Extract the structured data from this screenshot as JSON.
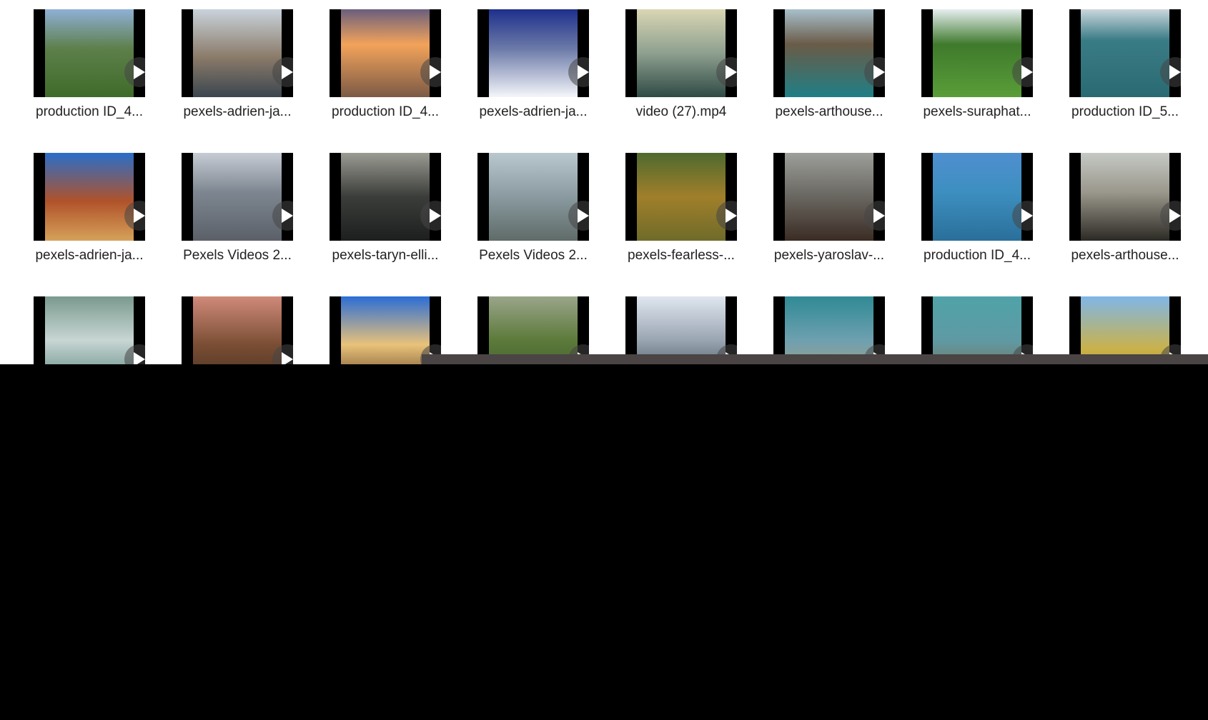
{
  "videos": [
    {
      "name": "production ID_4...",
      "bg": "linear-gradient(180deg,#8fb0d6 0%,#5d7f4a 45%,#3f6b2a 100%)",
      "play_icon": "play-icon"
    },
    {
      "name": "pexels-adrien-ja...",
      "bg": "linear-gradient(180deg,#c9d3dc 0%,#8a7a68 55%,#3b4650 100%)",
      "play_icon": "play-icon"
    },
    {
      "name": "production ID_4...",
      "bg": "linear-gradient(180deg,#6a5f7d 0%,#f3a35a 40%,#7b5a45 100%)",
      "play_icon": "play-icon"
    },
    {
      "name": "pexels-adrien-ja...",
      "bg": "linear-gradient(180deg,#1e2f8c 0%,#6c7aa8 45%,#f4f6fa 100%)",
      "play_icon": "play-icon"
    },
    {
      "name": "video (27).mp4",
      "bg": "linear-gradient(180deg,#d9d6b4 0%,#8ea08f 50%,#2f4a45 100%)",
      "play_icon": "play-icon"
    },
    {
      "name": "pexels-arthouse...",
      "bg": "linear-gradient(180deg,#a8c0cc 0%,#6a5b47 40%,#1f7f86 100%)",
      "play_icon": "play-icon"
    },
    {
      "name": "pexels-suraphat...",
      "bg": "linear-gradient(180deg,#e6eef0 0%,#3f7a2c 40%,#5a9d38 100%)",
      "play_icon": "play-icon"
    },
    {
      "name": "production ID_5...",
      "bg": "linear-gradient(180deg,#cbd7dd 0%,#3a7c86 35%,#2a6a72 100%)",
      "play_icon": "play-icon"
    },
    {
      "name": "pexels-adrien-ja...",
      "bg": "linear-gradient(180deg,#2a6ec9 0%,#b0522a 55%,#d6a25a 100%)",
      "play_icon": "play-icon"
    },
    {
      "name": "Pexels Videos 2...",
      "bg": "linear-gradient(180deg,#c7ccd4 0%,#7d8690 45%,#5b6068 100%)",
      "play_icon": "play-icon"
    },
    {
      "name": "pexels-taryn-elli...",
      "bg": "linear-gradient(180deg,#9a9b92 0%,#3b3d3a 50%,#1d1f1f 100%)",
      "play_icon": "play-icon"
    },
    {
      "name": "Pexels Videos 2...",
      "bg": "linear-gradient(180deg,#b9c8cf 0%,#8a9aa0 50%,#5f6b68 100%)",
      "play_icon": "play-icon"
    },
    {
      "name": "pexels-fearless-...",
      "bg": "linear-gradient(180deg,#4e6a2f 0%,#a07f2a 50%,#6f6b2a 100%)",
      "play_icon": "play-icon"
    },
    {
      "name": "pexels-yaroslav-...",
      "bg": "linear-gradient(180deg,#9d9f9a 0%,#6e6c66 45%,#3a2c24 100%)",
      "play_icon": "play-icon"
    },
    {
      "name": "production ID_4...",
      "bg": "linear-gradient(180deg,#4f8fd0 0%,#3d8fc0 45%,#2a6f9a 100%)",
      "play_icon": "play-icon"
    },
    {
      "name": "pexels-arthouse...",
      "bg": "linear-gradient(180deg,#c5c9c4 0%,#9a978c 45%,#2c2a24 100%)",
      "play_icon": "play-icon"
    },
    {
      "name": "",
      "bg": "linear-gradient(180deg,#7a9a8f 0%,#c8d6d4 50%,#5f8a82 100%)",
      "play_icon": "play-icon"
    },
    {
      "name": "",
      "bg": "linear-gradient(180deg,#d08a7a 0%,#7a4e34 55%,#4a3222 100%)",
      "play_icon": "play-icon"
    },
    {
      "name": "",
      "bg": "linear-gradient(180deg,#2b6dd6 0%,#e9c27a 55%,#6a4a2a 100%)",
      "play_icon": "play-icon"
    },
    {
      "name": "",
      "bg": "linear-gradient(180deg,#9aa58a 0%,#5c7a3a 50%,#3d5a2a 100%)",
      "play_icon": "play-icon"
    },
    {
      "name": "",
      "bg": "linear-gradient(180deg,#dfe6ef 0%,#9aa5b2 50%,#3a4650 100%)",
      "play_icon": "play-icon"
    },
    {
      "name": "",
      "bg": "linear-gradient(180deg,#2f8a95 0%,#6ea0b0 50%,#b0a07a 100%)",
      "play_icon": "play-icon"
    },
    {
      "name": "",
      "bg": "linear-gradient(180deg,#4fa3a8 0%,#5f9aa4 50%,#7a6a4a 100%)",
      "play_icon": "play-icon"
    },
    {
      "name": "",
      "bg": "linear-gradient(180deg,#7fb6e8 0%,#c9b24a 60%,#b08a2a 100%)",
      "play_icon": "play-icon"
    }
  ],
  "colors": {
    "grid_bg": "#ffffff",
    "label_text": "#222222",
    "overlay_bar": "#4a4444",
    "panel": "#000000"
  }
}
